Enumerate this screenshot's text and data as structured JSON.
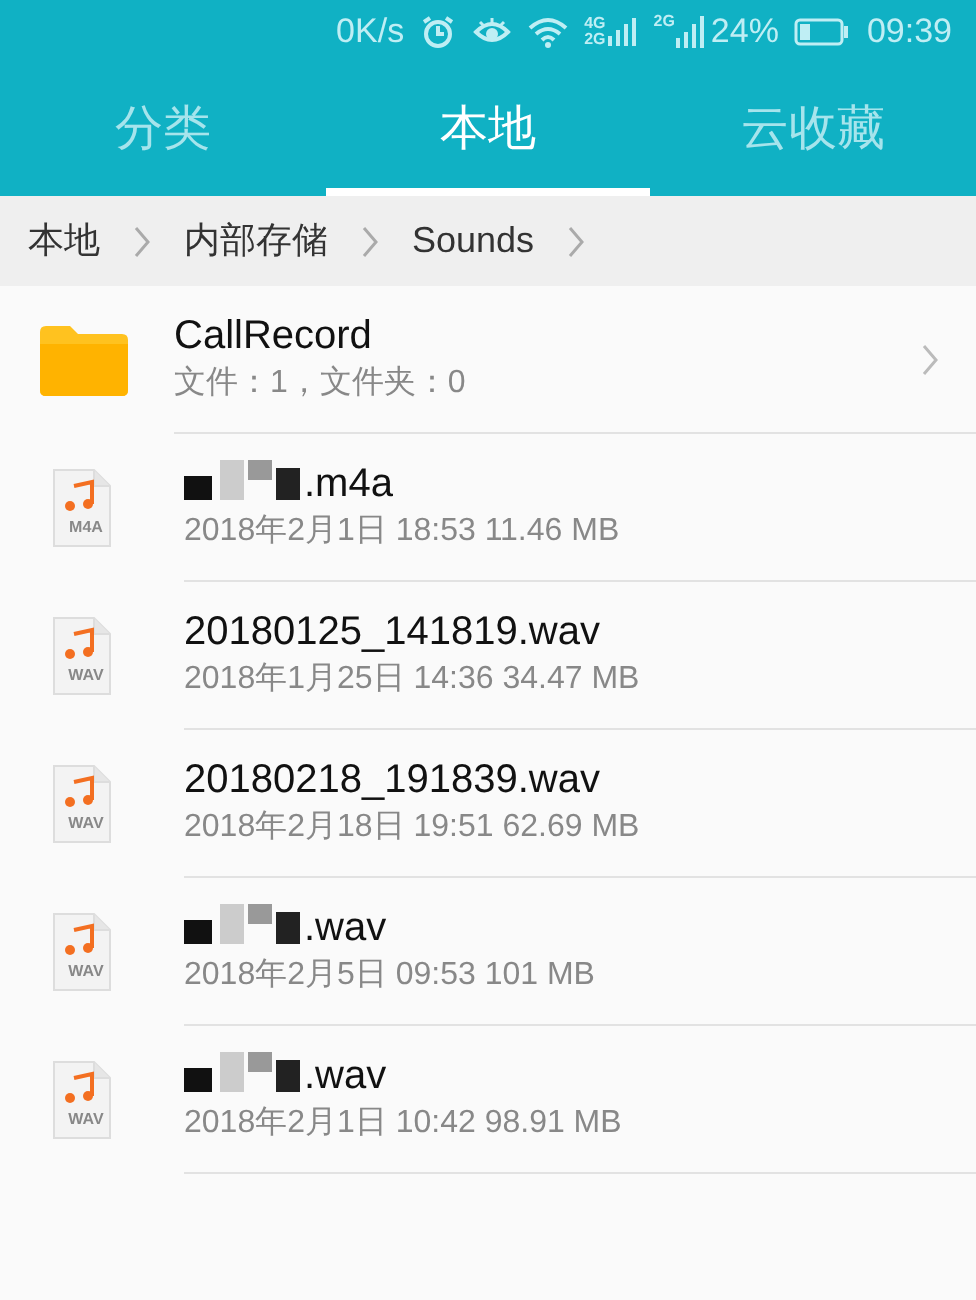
{
  "status_bar": {
    "speed": "0K/s",
    "sim_1_labels": [
      "4G",
      "2G"
    ],
    "sim_2_label": "2G",
    "battery_percent": "24%",
    "time": "09:39"
  },
  "tabs": [
    {
      "label": "分类",
      "selected": false
    },
    {
      "label": "本地",
      "selected": true
    },
    {
      "label": "云收藏",
      "selected": false
    }
  ],
  "breadcrumb": [
    "本地",
    "内部存储",
    "Sounds"
  ],
  "items": [
    {
      "kind": "folder",
      "name": "CallRecord",
      "details": "文件：1，文件夹：0"
    },
    {
      "kind": "file",
      "type_label": "M4A",
      "redacted": true,
      "name": ".m4a",
      "details": "2018年2月1日 18:53 11.46 MB"
    },
    {
      "kind": "file",
      "type_label": "WAV",
      "redacted": false,
      "name": "20180125_141819.wav",
      "details": "2018年1月25日 14:36 34.47 MB"
    },
    {
      "kind": "file",
      "type_label": "WAV",
      "redacted": false,
      "name": "20180218_191839.wav",
      "details": "2018年2月18日 19:51 62.69 MB"
    },
    {
      "kind": "file",
      "type_label": "WAV",
      "redacted": true,
      "name": ".wav",
      "details": "2018年2月5日 09:53 101 MB"
    },
    {
      "kind": "file",
      "type_label": "WAV",
      "redacted": true,
      "name": ".wav",
      "details": "2018年2月1日 10:42 98.91 MB"
    }
  ]
}
